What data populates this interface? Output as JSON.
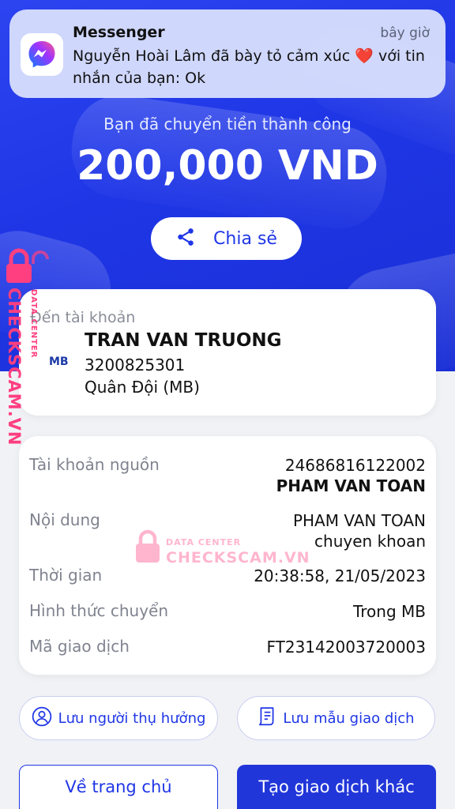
{
  "notification": {
    "app": "Messenger",
    "time": "bây giờ",
    "message_part1": "Nguyễn Hoài Lâm đã bày tỏ cảm xúc",
    "heart": "❤️",
    "message_part2": "với tin nhắn của bạn: Ok"
  },
  "transfer": {
    "status": "Bạn đã chuyển tiền thành công",
    "amount": "200,000 VND",
    "share_label": "Chia sẻ"
  },
  "destination": {
    "caption": "Đến tài khoản",
    "bank_logo": "MB",
    "name": "TRAN VAN TRUONG",
    "account": "3200825301",
    "bank": "Quân Đội (MB)"
  },
  "details": {
    "source_label": "Tài khoản nguồn",
    "source_account": "24686816122002",
    "source_name": "PHAM VAN TOAN",
    "content_label": "Nội dung",
    "content_line1": "PHAM VAN TOAN",
    "content_line2": "chuyen khoan",
    "time_label": "Thời gian",
    "time_value": "20:38:58, 21/05/2023",
    "method_label": "Hình thức chuyển",
    "method_value": "Trong MB",
    "code_label": "Mã giao dịch",
    "code_value": "FT23142003720003"
  },
  "actions": {
    "save_beneficiary": "Lưu người thụ hưởng",
    "save_template": "Lưu mẫu giao dịch",
    "home": "Về trang chủ",
    "new_transaction": "Tạo giao dịch khác"
  },
  "watermark": {
    "brand": "CHECKSCAM.VN",
    "sub": "DATA CENTER"
  },
  "colors": {
    "primary": "#1f36e6",
    "watermark": "#ff3f80"
  }
}
